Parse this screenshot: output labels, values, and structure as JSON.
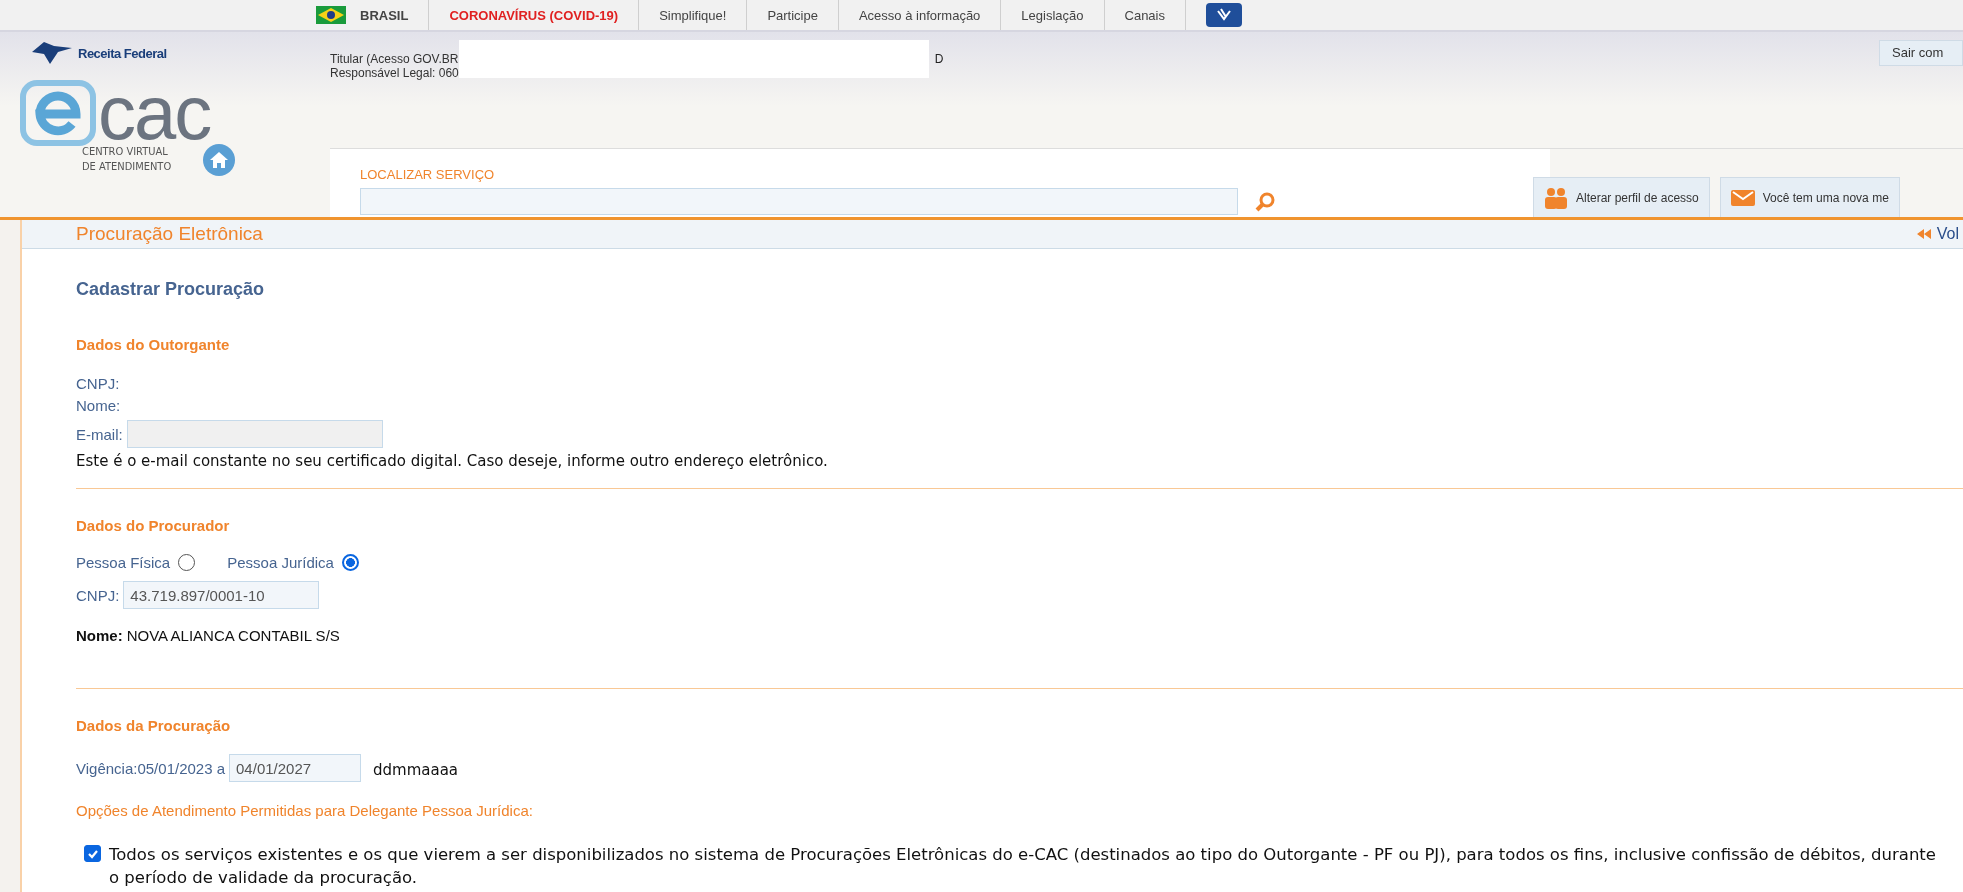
{
  "top_nav": {
    "items": [
      {
        "label": "BRASIL",
        "kind": "flag"
      },
      {
        "label": "CORONAVÍRUS (COVID-19)",
        "kind": "alert"
      },
      {
        "label": "Simplifique!",
        "kind": "link"
      },
      {
        "label": "Participe",
        "kind": "link"
      },
      {
        "label": "Acesso à informação",
        "kind": "link"
      },
      {
        "label": "Legislação",
        "kind": "link"
      },
      {
        "label": "Canais",
        "kind": "link"
      },
      {
        "kind": "hands"
      }
    ]
  },
  "header": {
    "brand": "Receita Federal",
    "user_lines": [
      "Titular (Acesso GOV.BR",
      "Responsável Legal: 060"
    ],
    "user_tail": "D",
    "logout": "Sair com",
    "logo_text": "cac",
    "logo_caption": [
      "CENTRO VIRTUAL",
      "DE ATENDIMENTO"
    ]
  },
  "search": {
    "label": "LOCALIZAR SERVIÇO"
  },
  "header_buttons": [
    {
      "label": "Alterar perfil de acesso",
      "kind": "people"
    },
    {
      "label": "Você tem uma nova me",
      "kind": "mail"
    }
  ],
  "panel": {
    "title": "Procuração Eletrônica",
    "back": "Vol",
    "heading": "Cadastrar Procuração"
  },
  "outorgante": {
    "title": "Dados do Outorgante",
    "cnpj_label": "CNPJ:",
    "name_label": "Nome:",
    "email_label": "E-mail:",
    "hint": "Este é o e-mail constante no seu certificado digital. Caso deseje, informe outro endereço eletrônico."
  },
  "procurador": {
    "title": "Dados do Procurador",
    "types": [
      {
        "label": "Pessoa Física",
        "selected": false
      },
      {
        "label": "Pessoa Jurídica",
        "selected": true
      }
    ],
    "cnpj_label": "CNPJ:",
    "cnpj": "43.719.897/0001-10",
    "name_label": "Nome:",
    "name": "NOVA ALIANCA CONTABIL S/S"
  },
  "procuracao": {
    "title": "Dados da Procuração",
    "validity_label": "Vigência:05/01/2023 a",
    "end_date": "04/01/2027",
    "date_format": "ddmmaaaa",
    "options_title": "Opções de Atendimento Permitidas para Delegante Pessoa Jurídica:",
    "options": [
      {
        "label": "Todos os serviços existentes e os que vierem a ser disponibilizados no sistema de Procurações Eletrônicas do e-CAC (destinados ao tipo do Outorgante - PF ou PJ), para todos os fins, inclusive confissão de débitos, durante o período de validade da procuração.",
        "checked": true
      }
    ]
  }
}
